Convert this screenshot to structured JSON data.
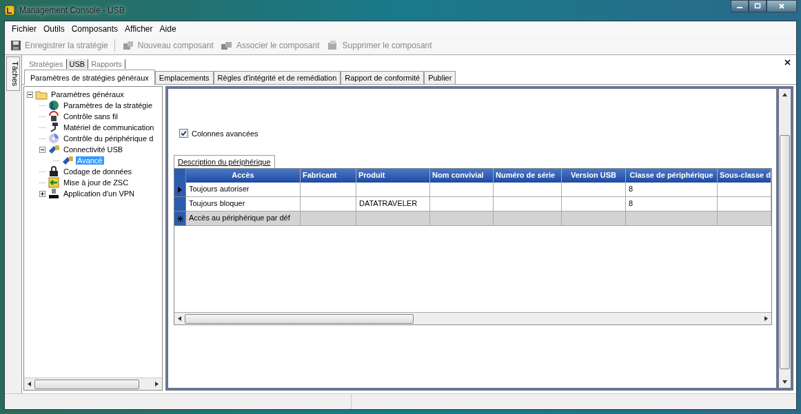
{
  "window": {
    "title": "Management Console  - USB"
  },
  "menu": [
    "Fichier",
    "Outils",
    "Composants",
    "Afficher",
    "Aide"
  ],
  "toolbar": [
    {
      "label": "Enregistrer la stratégie",
      "kind": "save",
      "disabled": true
    },
    {
      "label": "Nouveau composant",
      "kind": "new",
      "disabled": true
    },
    {
      "label": "Associer le composant",
      "kind": "assoc",
      "disabled": true
    },
    {
      "label": "Supprimer le composant",
      "kind": "delete",
      "disabled": true
    }
  ],
  "side_tab": "Tâches",
  "doc_tabs": [
    {
      "label": "Stratégies",
      "selected": false
    },
    {
      "label": "USB",
      "selected": true
    },
    {
      "label": "Rapports",
      "selected": false
    }
  ],
  "tabs": [
    {
      "label": "Paramètres de stratégies généraux",
      "selected": true
    },
    {
      "label": "Emplacements",
      "selected": false
    },
    {
      "label": "Règles d'intégrité et de remédiation",
      "selected": false
    },
    {
      "label": "Rapport de conformité",
      "selected": false
    },
    {
      "label": "Publier",
      "selected": false
    }
  ],
  "tree": [
    {
      "label": "Paramètres généraux",
      "expanded": true,
      "selected": false,
      "children": [
        {
          "label": "Paramètres de la stratégie",
          "selected": false
        },
        {
          "label": "Contrôle sans fil",
          "selected": false
        },
        {
          "label": "Matériel de communication",
          "selected": false
        },
        {
          "label": "Contrôle du périphérique d",
          "selected": false
        },
        {
          "label": "Connectivité USB",
          "expanded": true,
          "selected": false,
          "children": [
            {
              "label": "Avancé",
              "selected": true
            }
          ]
        },
        {
          "label": "Codage de données",
          "selected": false
        },
        {
          "label": "Mise à jour de ZSC",
          "selected": false
        },
        {
          "label": "Application d'un VPN",
          "expanded": false,
          "selected": false
        }
      ]
    }
  ],
  "advanced_columns": {
    "label": "Colonnes avancées",
    "checked": true
  },
  "grid_tab": "Description du périphérique",
  "table": {
    "columns": [
      "Accès",
      "Fabricant",
      "Produit",
      "Nom convivial",
      "Numéro de série",
      "Version USB",
      "Classe de périphérique",
      "Sous-classe d"
    ],
    "rows": [
      {
        "kind": "current",
        "cells": [
          "Toujours autoriser",
          "",
          "",
          "",
          "",
          "",
          "8",
          ""
        ]
      },
      {
        "kind": "plain",
        "cells": [
          "Toujours bloquer",
          "",
          "DATATRAVELER",
          "",
          "",
          "",
          "8",
          ""
        ]
      },
      {
        "kind": "new",
        "cells": [
          "Accès au périphérique par déf",
          "",
          "",
          "",
          "",
          "",
          "",
          ""
        ]
      }
    ]
  }
}
